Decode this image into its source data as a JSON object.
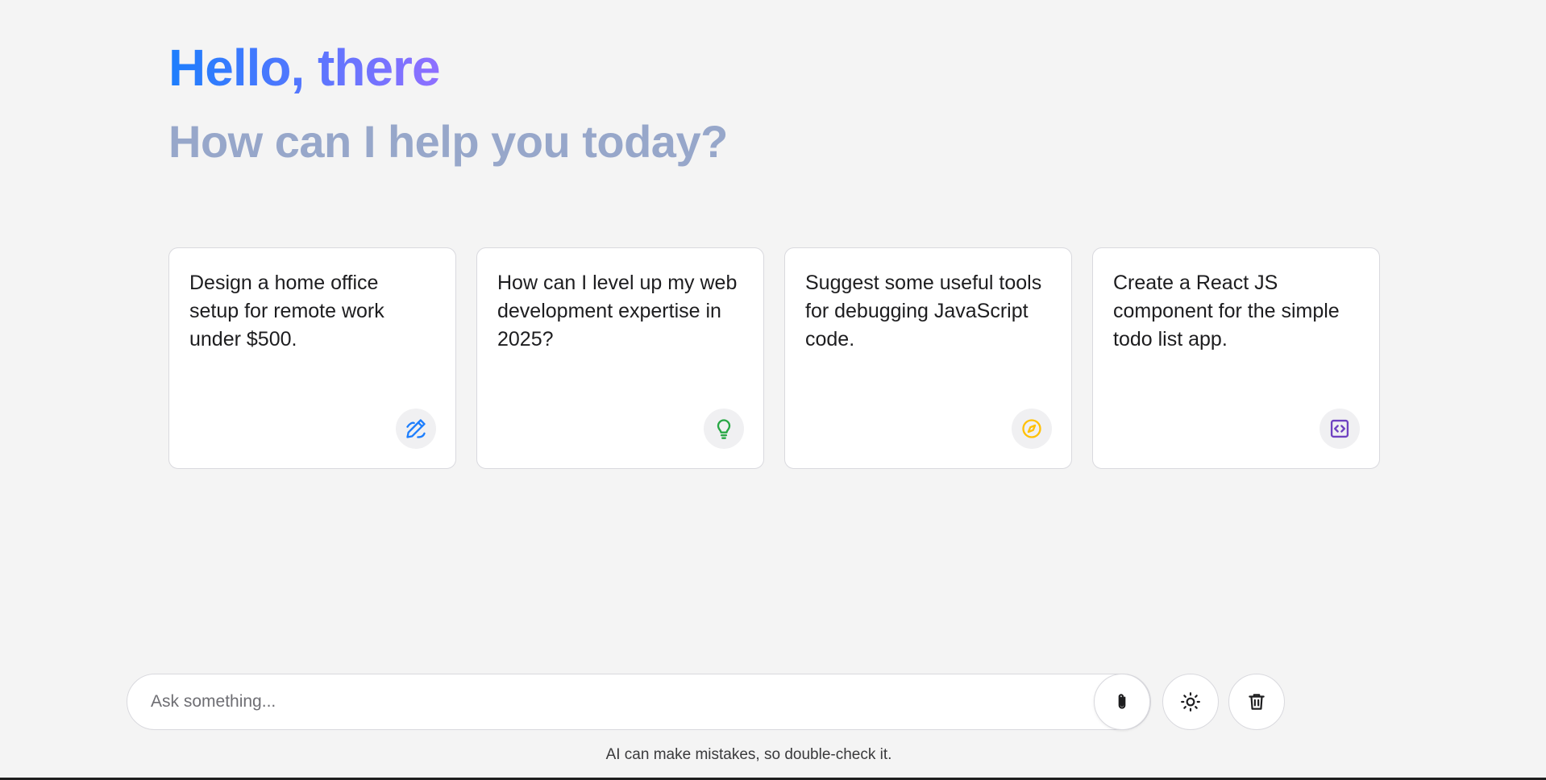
{
  "header": {
    "greeting": "Hello, there",
    "subheading": "How can I help you today?"
  },
  "suggestions": [
    {
      "text": "Design a home office setup for remote work under $500.",
      "icon": "pencil-icon",
      "icon_color": "#1d7efd"
    },
    {
      "text": "How can I level up my web development expertise in 2025?",
      "icon": "lightbulb-icon",
      "icon_color": "#28a745"
    },
    {
      "text": "Suggest some useful tools for debugging JavaScript code.",
      "icon": "compass-icon",
      "icon_color": "#ffc107"
    },
    {
      "text": "Create a React JS component for the simple todo list app.",
      "icon": "code-icon",
      "icon_color": "#6f42c1"
    }
  ],
  "prompt": {
    "placeholder": "Ask something...",
    "value": ""
  },
  "actions": {
    "attach_icon": "paperclip-icon",
    "theme_icon": "sun-icon",
    "delete_icon": "trash-icon"
  },
  "footer": {
    "disclaimer": "AI can make mistakes, so double-check it."
  },
  "colors": {
    "background": "#f4f4f4",
    "gradient_start": "#1d7efd",
    "gradient_end": "#8f6fff",
    "subheading": "#97a7ca"
  }
}
